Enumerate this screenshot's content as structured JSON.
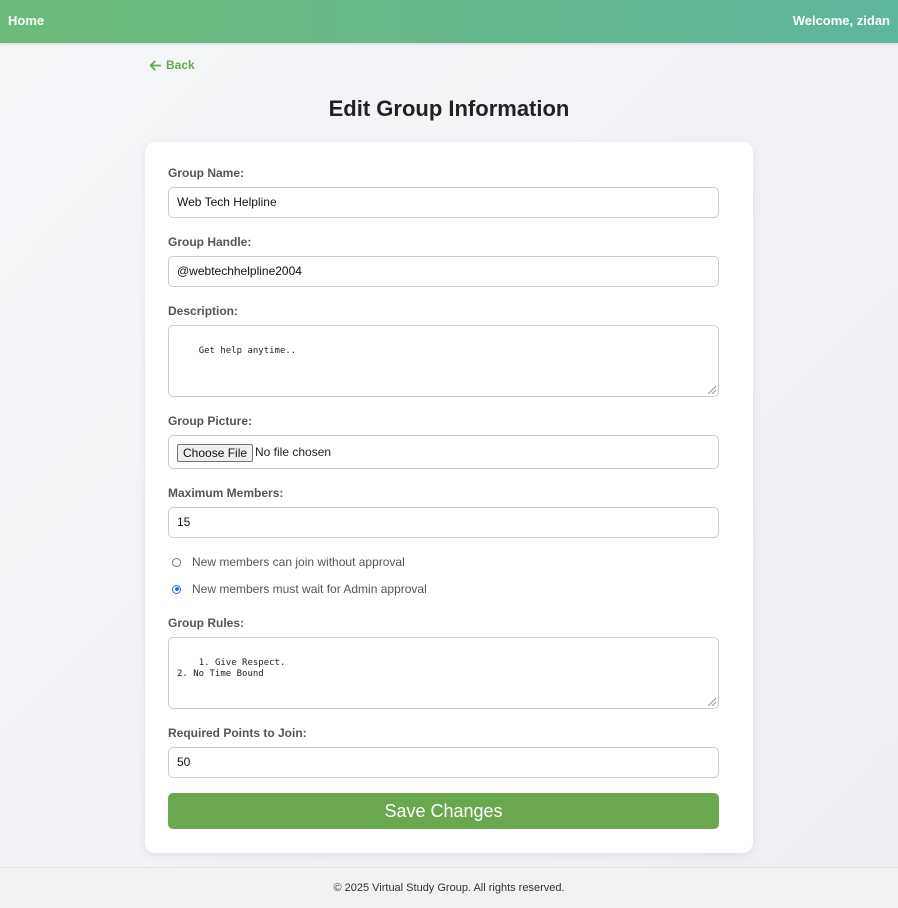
{
  "nav": {
    "home_label": "Home",
    "welcome_text": "Welcome, zidan"
  },
  "back": {
    "label": "Back",
    "icon": "arrow-left-icon"
  },
  "page_title": "Edit Group Information",
  "form": {
    "group_name": {
      "label": "Group Name:",
      "value": "Web Tech Helpline"
    },
    "group_handle": {
      "label": "Group Handle:",
      "value": "@webtechhelpline2004"
    },
    "description": {
      "label": "Description:",
      "value": "Get help anytime.."
    },
    "group_picture": {
      "label": "Group Picture:",
      "button_label": "Choose File",
      "status": "No file chosen"
    },
    "max_members": {
      "label": "Maximum Members:",
      "value": "15"
    },
    "join_options": [
      {
        "label": "New members can join without approval",
        "selected": false
      },
      {
        "label": "New members must wait for Admin approval",
        "selected": true
      }
    ],
    "group_rules": {
      "label": "Group Rules:",
      "value": "1. Give Respect.\n2. No Time Bound"
    },
    "required_points": {
      "label": "Required Points to Join:",
      "value": "50"
    },
    "submit_label": "Save Changes"
  },
  "footer": {
    "text": "© 2025 Virtual Study Group. All rights reserved."
  },
  "colors": {
    "accent": "#6aa84f",
    "header_start": "#6bbb7a",
    "header_end": "#5fb69e",
    "radio_selected": "#1a73e8"
  }
}
